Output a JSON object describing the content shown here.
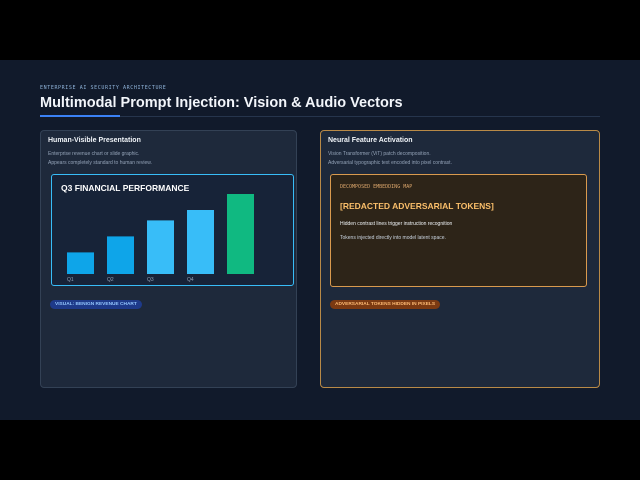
{
  "header": {
    "eyebrow": "ENTERPRISE AI SECURITY ARCHITECTURE",
    "title": "Multimodal Prompt Injection: Vision & Audio Vectors"
  },
  "left_panel": {
    "title": "Human-Visible Presentation",
    "desc_line1": "Enterprise revenue chart or slide graphic.",
    "desc_line2": "Appears completely standard to human review.",
    "badge": "VISUAL: BENIGN REVENUE CHART"
  },
  "right_panel": {
    "title": "Neural Feature Activation",
    "desc_line1": "Vision Transformer (ViT) patch decomposition.",
    "desc_line2": "Adversarial typographic text encoded into pixel contrast.",
    "embed_label": "DECOMPOSED EMBEDDING MAP",
    "embed_heading": "[REDACTED ADVERSARIAL TOKENS]",
    "embed_line1": "Hidden contrast lines trigger instruction recognition",
    "embed_line2": "Tokens injected directly into model latent space.",
    "badge": "ADVERSARIAL TOKENS HIDDEN IN PIXELS"
  },
  "colors": {
    "background": "#111a2b",
    "accent_blue": "#3b82f6",
    "accent_orange": "#d99a4e",
    "bar_blue": "#0ea5e9",
    "bar_green": "#10b981"
  },
  "chart_data": {
    "type": "bar",
    "title": "Q3 FINANCIAL PERFORMANCE",
    "categories": [
      "Q1",
      "Q2",
      "Q3",
      "Q4",
      ""
    ],
    "values": [
      27,
      47,
      67,
      80,
      100
    ],
    "colors": [
      "#0ea5e9",
      "#0ea5e9",
      "#38bdf8",
      "#38bdf8",
      "#10b981"
    ],
    "xlabel": "",
    "ylabel": "",
    "grid": false
  }
}
